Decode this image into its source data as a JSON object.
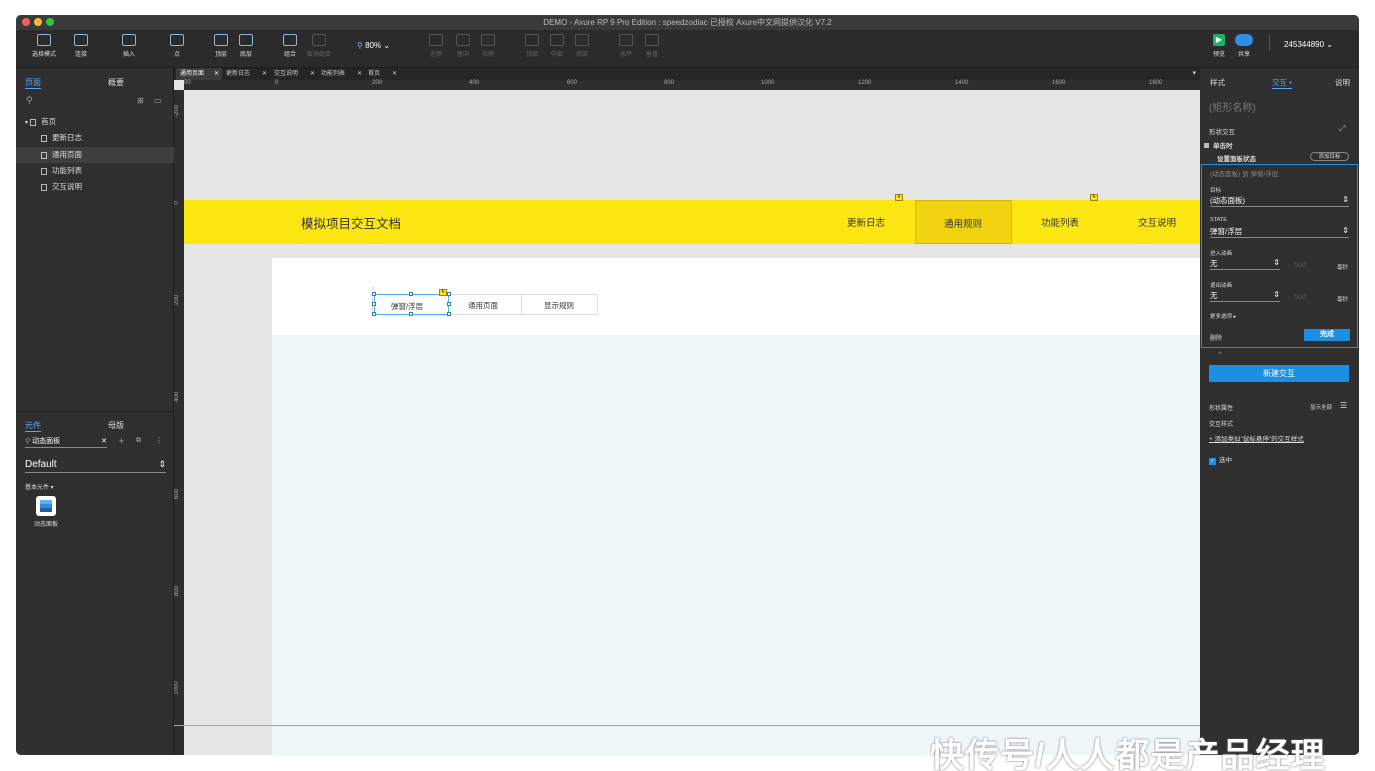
{
  "window": {
    "title": "DEMO - Axure RP 9 Pro Edition : speedzodiac 已授权     Axure中文网提供汉化 V7.2"
  },
  "toolbar": {
    "select_mode": "选择模式",
    "connect": "连接",
    "insert": "插入",
    "point": "点",
    "top": "顶层",
    "bottom": "底层",
    "group": "组合",
    "ungroup": "取消组合",
    "zoom": "80%",
    "left": "左侧",
    "center": "居中",
    "right": "右侧",
    "top_align": "顶部",
    "middle": "中部",
    "bottom_align": "底部",
    "horizontal": "水平",
    "vertical": "垂直",
    "preview": "预览",
    "share": "共享",
    "account": "245344890"
  },
  "left_panel": {
    "tabs": [
      "页面",
      "概要"
    ],
    "pages": [
      {
        "label": "首页",
        "level": 0
      },
      {
        "label": "更新日志",
        "level": 1
      },
      {
        "label": "通用页面",
        "level": 1,
        "selected": true
      },
      {
        "label": "功能列表",
        "level": 1
      },
      {
        "label": "交互说明",
        "level": 1
      }
    ],
    "lib_tabs": [
      "元件",
      "母版"
    ],
    "lib_search": "动态面板",
    "library": "Default",
    "category": "基本元件",
    "widget": "动态面板"
  },
  "doc_tabs": [
    {
      "label": "通用页面",
      "active": true
    },
    {
      "label": "更新日志"
    },
    {
      "label": "交互说明"
    },
    {
      "label": "功能列表"
    },
    {
      "label": "首页"
    }
  ],
  "ruler": {
    "h": [
      "00",
      "0",
      "200",
      "400",
      "600",
      "800",
      "1000",
      "1200",
      "1400",
      "1600",
      "1800"
    ],
    "v": [
      "-200",
      "0",
      "200",
      "400",
      "600",
      "800",
      "1000"
    ]
  },
  "canvas": {
    "brand": "模拟项目交互文档",
    "nav": [
      {
        "label": "更新日志"
      },
      {
        "label": "通用规则",
        "active": true
      },
      {
        "label": "功能列表"
      },
      {
        "label": "交互说明"
      }
    ],
    "subtabs": [
      "弹窗/浮层",
      "通用页面",
      "显示规则"
    ],
    "colors": {
      "header": "#fde712",
      "nav_active": "#f2d312",
      "content": "#eff6fa"
    }
  },
  "right_panel": {
    "tabs": [
      "样式",
      "交互 •",
      "说明"
    ],
    "shape_name": "(矩形名称)",
    "section": "形状交互",
    "event": "单击时",
    "action": "设置面板状态",
    "add_target": "添加目标",
    "summary": "(动态面板) 到 弹窗/浮层",
    "target_label": "目标",
    "target_value": "(动态面板)",
    "state_label": "STATE",
    "state_value": "弹窗/浮层",
    "enter_label": "进入动画",
    "enter_value": "无",
    "enter_ms": "500",
    "exit_label": "退出动画",
    "exit_value": "无",
    "exit_ms": "500",
    "unit": "毫秒",
    "more": "更多选项 ▸",
    "delete": "删除",
    "done": "完成",
    "new_interaction": "新建交互",
    "props": "形状属性",
    "show_all": "显示全部",
    "interaction_style": "交互样式",
    "add_hover": "添加类似\"鼠标悬停\"的交互样式",
    "selected": "选中",
    "accent": "#1a8fe3"
  },
  "watermark": "快传号/人人都是产品经理"
}
